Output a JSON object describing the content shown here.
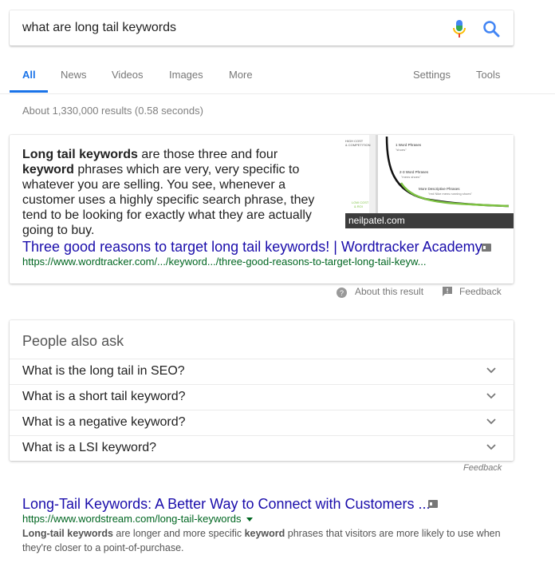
{
  "search": {
    "query": "what are long tail keywords"
  },
  "tabs": {
    "all": "All",
    "news": "News",
    "videos": "Videos",
    "images": "Images",
    "more": "More",
    "settings": "Settings",
    "tools": "Tools"
  },
  "result_stats": "About 1,330,000 results (0.58 seconds)",
  "featured_snippet": {
    "text_parts": [
      {
        "t": "Long tail keywords",
        "b": true
      },
      {
        "t": " are those three and four ",
        "b": false
      },
      {
        "t": "keyword",
        "b": true
      },
      {
        "t": " phrases which are very, very specific to whatever you are selling. You see, whenever a customer uses a highly specific search phrase, they tend to be looking for exactly what they are actually going to buy.",
        "b": false
      }
    ],
    "image_caption": "neilpatel.com",
    "image_labels": {
      "high_cost": "HIGH COST",
      "competition": "& COMPETITION",
      "word1": "1 Word Phrases",
      "word1_ex": "\"shoes\"",
      "word23": "2-3 Word Phrases",
      "word23_ex": "\"mens shoes\"",
      "more_desc": "More Descriptive Phrases",
      "more_desc_ex": "\"red Nike mens running shoes\"",
      "low_cost": "LOW COST",
      "roi": "& ROI"
    },
    "link_title": "Three good reasons to target long tail keywords! | Wordtracker Academy",
    "url": "https://www.wordtracker.com/.../keyword.../three-good-reasons-to-target-long-tail-keyw..."
  },
  "about": {
    "about_label": "About this result",
    "feedback_label": "Feedback"
  },
  "people_also_ask": {
    "title": "People also ask",
    "questions": [
      "What is the long tail in SEO?",
      "What is a short tail keyword?",
      "What is a negative keyword?",
      "What is a LSI keyword?"
    ],
    "feedback": "Feedback"
  },
  "result2": {
    "title": "Long-Tail Keywords: A Better Way to Connect with Customers ...",
    "url": "https://www.wordstream.com/long-tail-keywords",
    "snippet_parts": [
      {
        "t": "Long-tail keywords",
        "b": true
      },
      {
        "t": " are longer and more specific ",
        "b": false
      },
      {
        "t": "keyword",
        "b": true
      },
      {
        "t": " phrases that visitors are more likely to use when they're closer to a point-of-purchase.",
        "b": false
      }
    ]
  },
  "colors": {
    "link": "#1a0dab",
    "url": "#006621",
    "accent": "#1a73e8",
    "curve_green": "#7dc242"
  }
}
